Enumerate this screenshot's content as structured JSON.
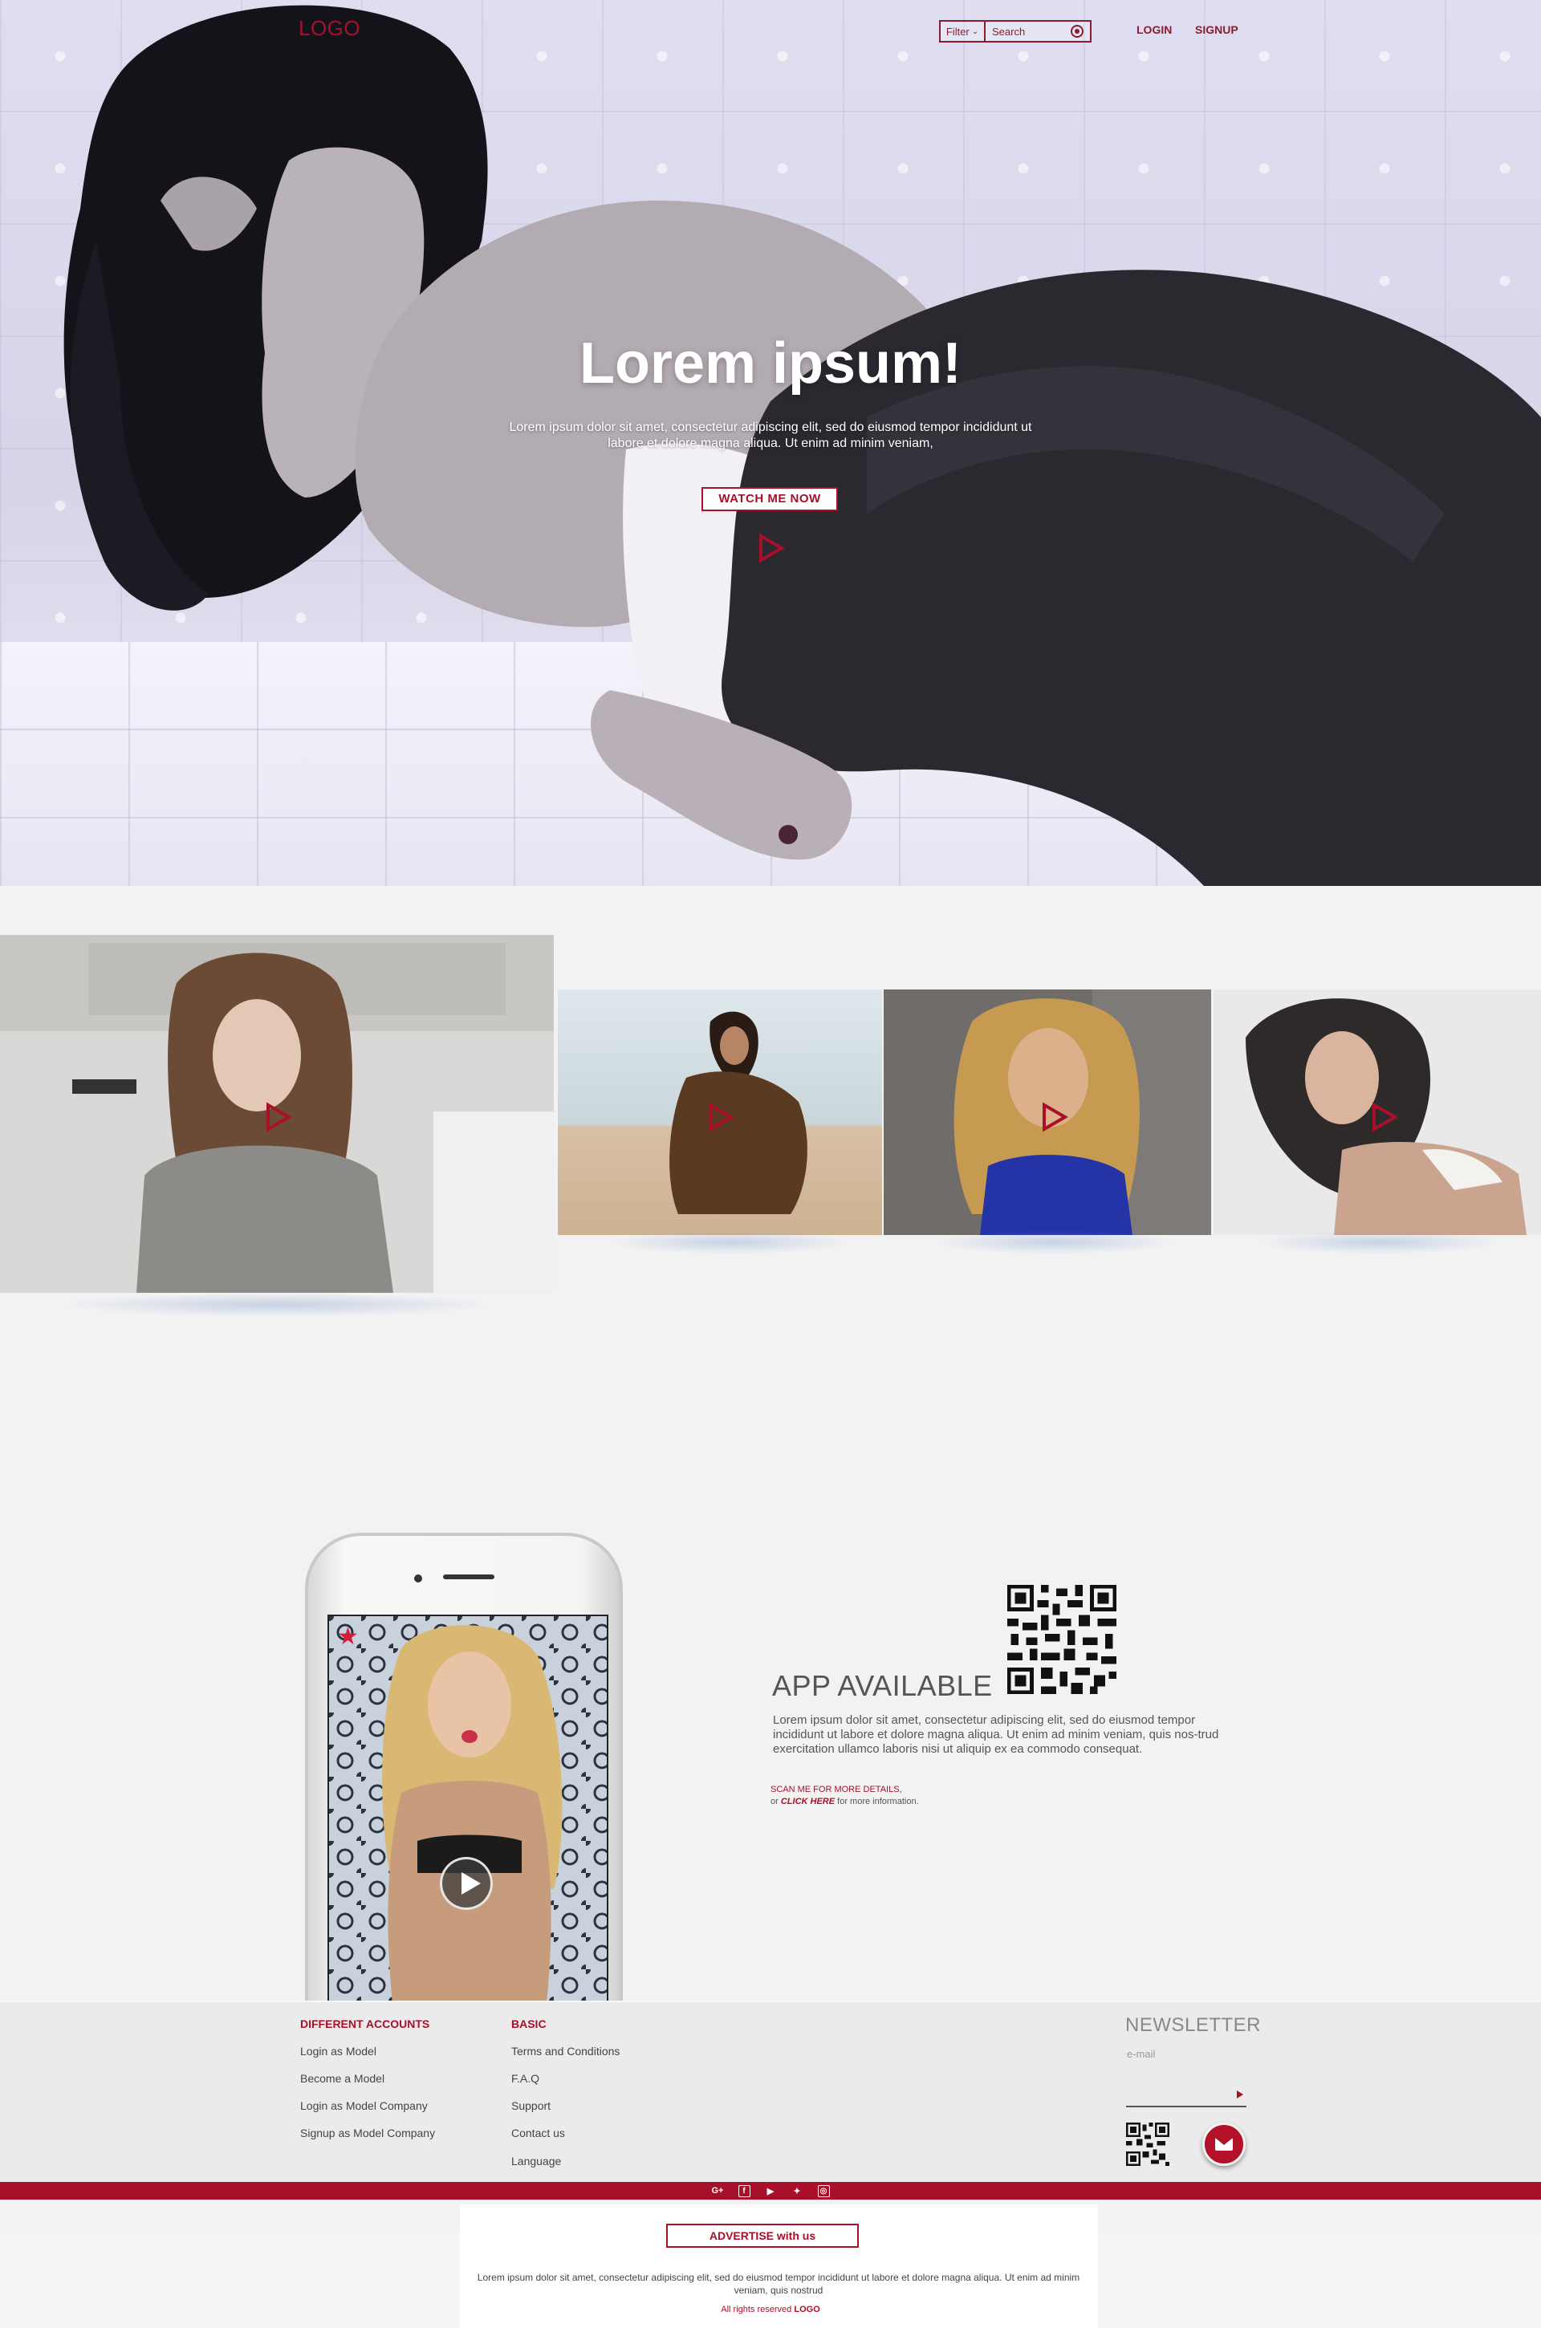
{
  "header": {
    "logo": "LOGO",
    "filter_label": "Filter",
    "search_placeholder": "Search",
    "login": "LOGIN",
    "signup": "SIGNUP"
  },
  "hero": {
    "title": "Lorem ipsum!",
    "text": "Lorem ipsum dolor sit amet, consectetur adipiscing elit, sed do eiusmod tempor incididunt ut labore et dolore magna aliqua. Ut enim ad minim veniam,",
    "cta": "WATCH ME NOW"
  },
  "gallery": {
    "items": [
      {
        "name": "model-1"
      },
      {
        "name": "model-2"
      },
      {
        "name": "model-3"
      },
      {
        "name": "model-4"
      }
    ]
  },
  "app": {
    "title": "APP AVAILABLE",
    "text": "Lorem ipsum dolor sit amet, consectetur adipiscing elit, sed do eiusmod tempor incididunt ut labore et dolore magna aliqua. Ut enim ad minim veniam, quis nos-trud exercitation ullamco laboris nisi ut aliquip ex ea commodo consequat.",
    "scan": "SCAN ME FOR MORE DETAILS,",
    "or": "or",
    "click_here": "CLICK HERE",
    "more_info": "for more information."
  },
  "footer": {
    "col1_title": "DIFFERENT ACCOUNTS",
    "col1_links": [
      "Login as Model",
      "Become a Model",
      "Login as Model Company",
      "Signup as Model Company"
    ],
    "col2_title": "BASIC",
    "col2_links": [
      "Terms and Conditions",
      "F.A.Q",
      "Support",
      "Contact us",
      "Language"
    ],
    "newsletter_title": "NEWSLETTER",
    "newsletter_placeholder": "e-mail",
    "social_icons": [
      "google-plus-icon",
      "facebook-icon",
      "youtube-icon",
      "twitter-icon",
      "instagram-icon"
    ],
    "advertise": "ADVERTISE with us",
    "bottom_text": "Lorem ipsum dolor sit amet, consectetur adipiscing elit, sed do eiusmod tempor incididunt ut labore et dolore magna aliqua. Ut enim ad minim veniam, quis nostrud",
    "rights_prefix": "All rights reserved",
    "rights_logo": "LOGO"
  },
  "colors": {
    "accent": "#a8102a",
    "background": "#f2f2f3",
    "footer": "#ebebeb"
  }
}
